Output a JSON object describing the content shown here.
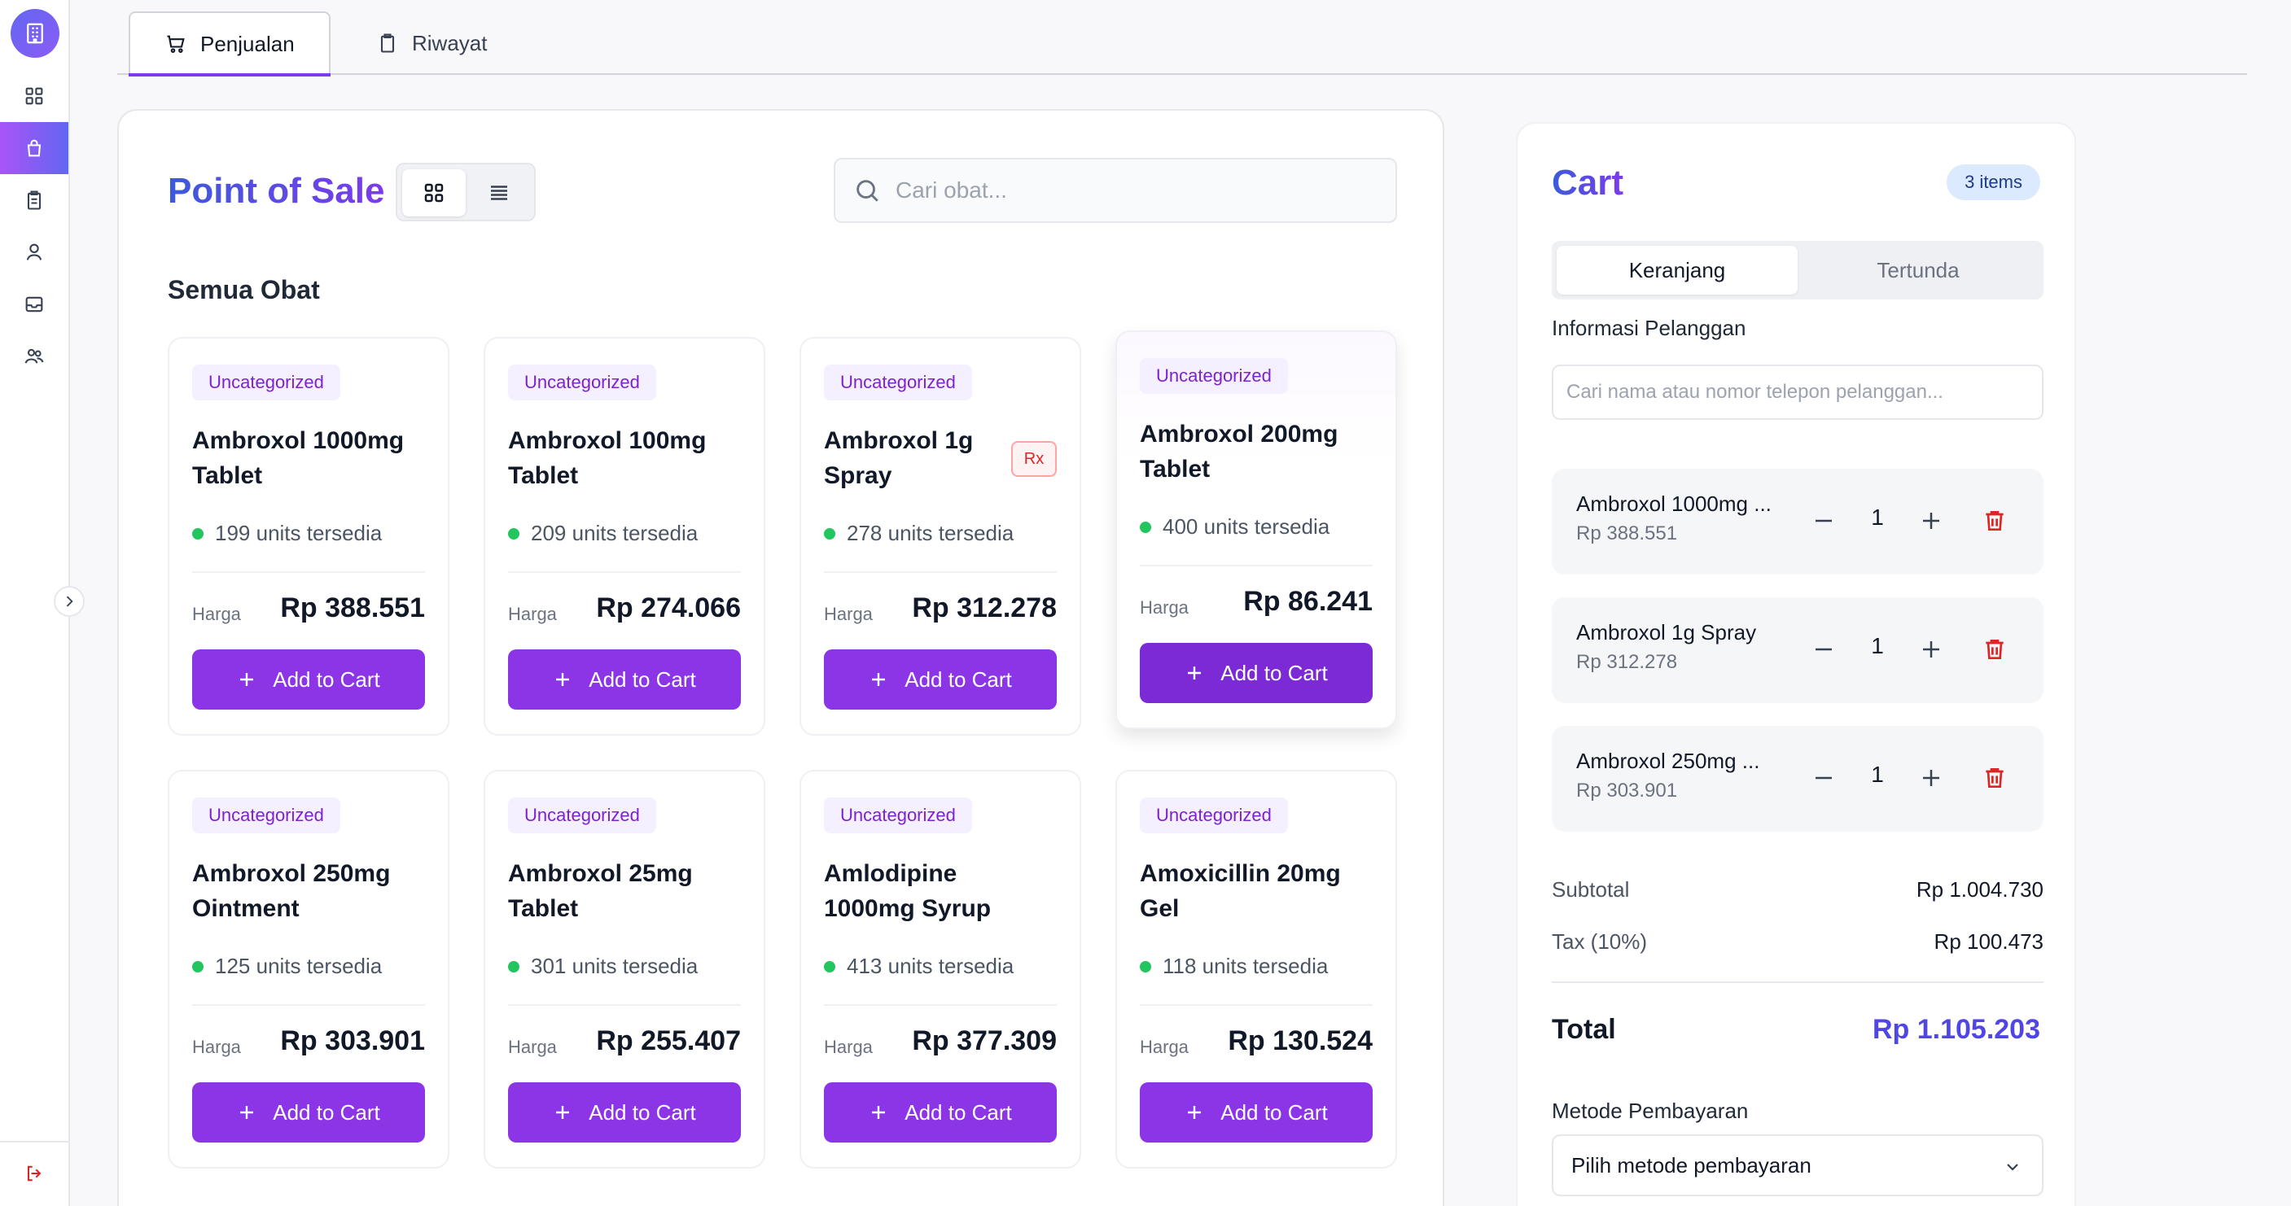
{
  "tabs": [
    {
      "label": "Penjualan",
      "icon": "cart-icon",
      "active": true
    },
    {
      "label": "Riwayat",
      "icon": "clipboard-icon",
      "active": false
    }
  ],
  "sidebar": {
    "items": [
      {
        "name": "dashboard",
        "icon": "grid-icon"
      },
      {
        "name": "sales",
        "icon": "shopping-bag-icon",
        "active": true
      },
      {
        "name": "orders",
        "icon": "clipboard-list-icon"
      },
      {
        "name": "customers",
        "icon": "user-icon"
      },
      {
        "name": "inbox",
        "icon": "inbox-icon"
      },
      {
        "name": "team",
        "icon": "users-icon"
      }
    ],
    "logout_icon": "logout-icon"
  },
  "pos": {
    "title": "Point of Sale",
    "search_placeholder": "Cari obat...",
    "section_title": "Semua Obat",
    "harga_label": "Harga",
    "add_label": "Add to Cart"
  },
  "products": [
    {
      "category": "Uncategorized",
      "name": "Ambroxol 1000mg Tablet",
      "stock": "199 units tersedia",
      "price": "Rp 388.551",
      "rx": ""
    },
    {
      "category": "Uncategorized",
      "name": "Ambroxol 100mg Tablet",
      "stock": "209 units tersedia",
      "price": "Rp 274.066",
      "rx": ""
    },
    {
      "category": "Uncategorized",
      "name": "Ambroxol 1g Spray",
      "stock": "278 units tersedia",
      "price": "Rp 312.278",
      "rx": "Rx"
    },
    {
      "category": "Uncategorized",
      "name": "Ambroxol 200mg Tablet",
      "stock": "400 units tersedia",
      "price": "Rp 86.241",
      "rx": ""
    },
    {
      "category": "Uncategorized",
      "name": "Ambroxol 250mg Ointment",
      "stock": "125 units tersedia",
      "price": "Rp 303.901",
      "rx": ""
    },
    {
      "category": "Uncategorized",
      "name": "Ambroxol 25mg Tablet",
      "stock": "301 units tersedia",
      "price": "Rp 255.407",
      "rx": ""
    },
    {
      "category": "Uncategorized",
      "name": "Amlodipine 1000mg Syrup",
      "stock": "413 units tersedia",
      "price": "Rp 377.309",
      "rx": ""
    },
    {
      "category": "Uncategorized",
      "name": "Amoxicillin 20mg Gel",
      "stock": "118 units tersedia",
      "price": "Rp 130.524",
      "rx": ""
    }
  ],
  "cart": {
    "title": "Cart",
    "count": "3 items",
    "tab_active": "Keranjang",
    "tab_other": "Tertunda",
    "customer_label": "Informasi Pelanggan",
    "customer_placeholder": "Cari nama atau nomor telepon pelanggan...",
    "items": [
      {
        "name": "Ambroxol 1000mg ...",
        "price": "Rp 388.551",
        "qty": "1"
      },
      {
        "name": "Ambroxol 1g Spray",
        "price": "Rp 312.278",
        "qty": "1"
      },
      {
        "name": "Ambroxol 250mg ...",
        "price": "Rp 303.901",
        "qty": "1"
      }
    ],
    "subtotal_label": "Subtotal",
    "subtotal": "Rp 1.004.730",
    "tax_label": "Tax (10%)",
    "tax": "Rp 100.473",
    "total_label": "Total",
    "total": "Rp 1.105.203",
    "payment_label": "Metode Pembayaran",
    "payment_value": "Pilih metode pembayaran"
  },
  "colors": {
    "accent": "#8b35e6",
    "brand_blue": "#4f46e5",
    "stock_green": "#22c55e",
    "delete_red": "#dc2626"
  }
}
